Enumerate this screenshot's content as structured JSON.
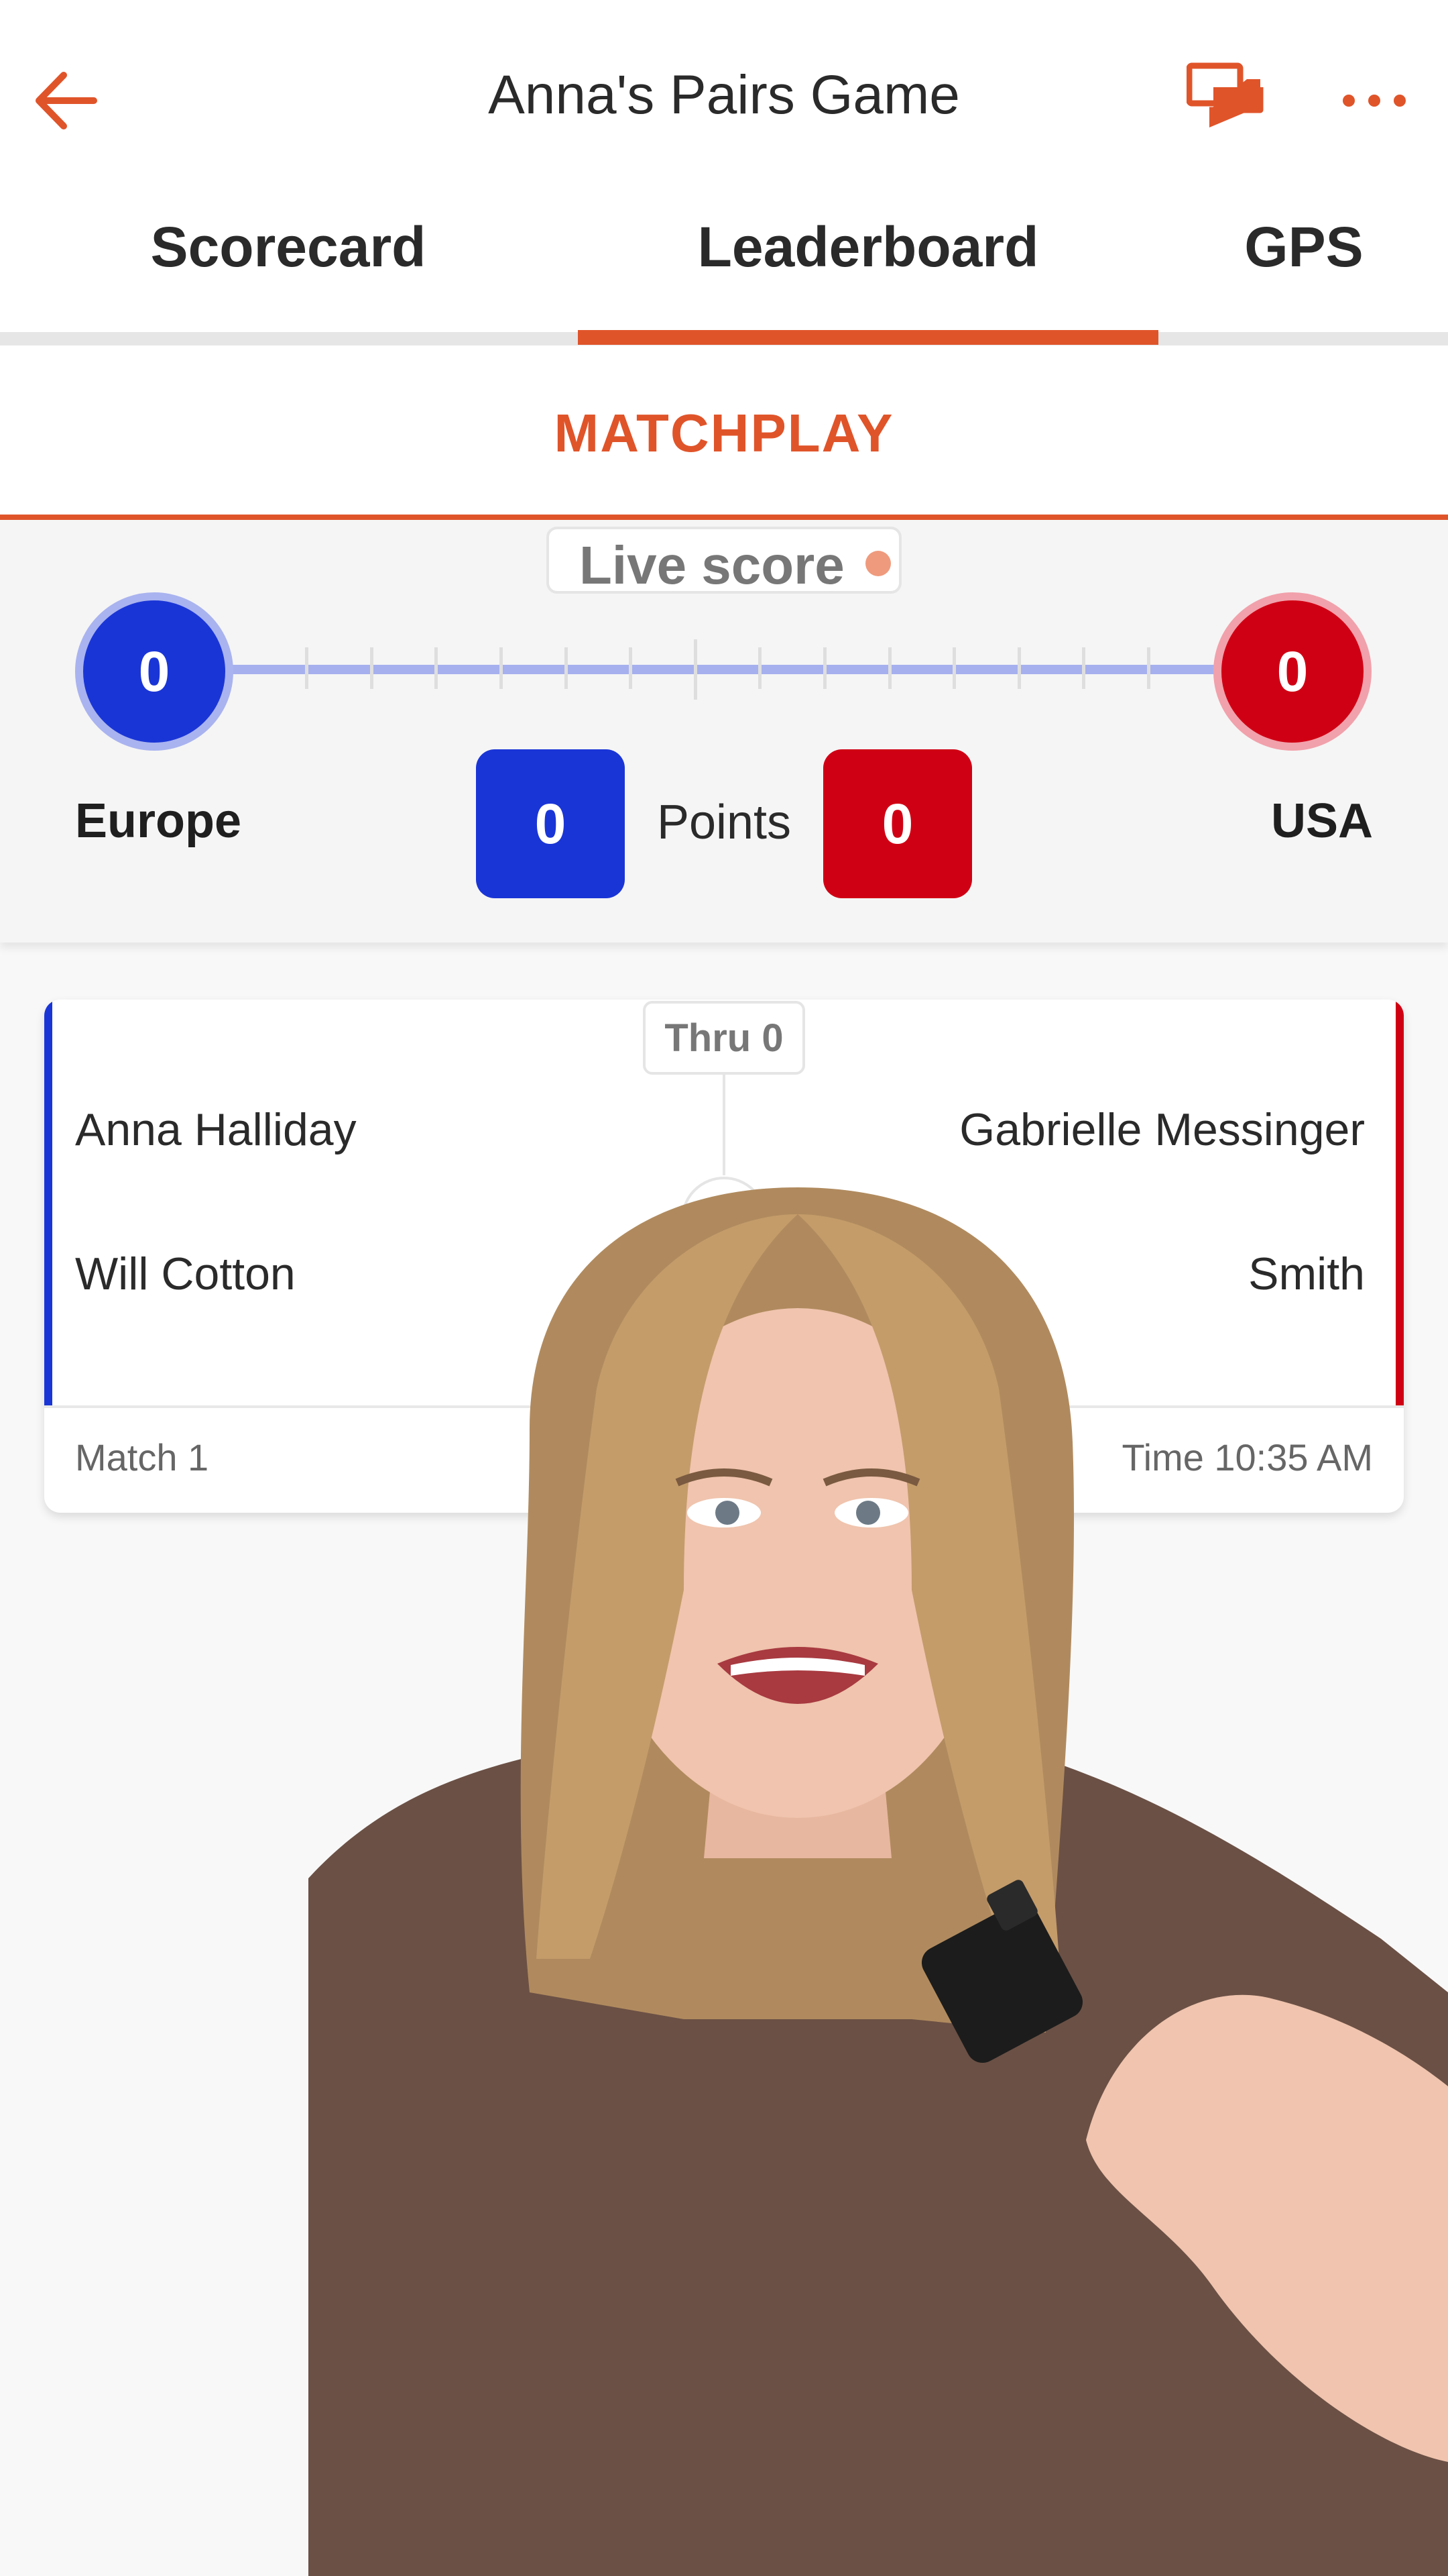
{
  "header": {
    "title": "Anna's Pairs Game"
  },
  "tabs": [
    {
      "label": "Scorecard"
    },
    {
      "label": "Leaderboard",
      "active": true
    },
    {
      "label": "GPS"
    }
  ],
  "mode": {
    "label": "MATCHPLAY"
  },
  "live": {
    "label": "Live score"
  },
  "scoreboard": {
    "team_left": {
      "name": "Europe",
      "holes_up": "0",
      "points": "0",
      "color": "#1a35d6"
    },
    "team_right": {
      "name": "USA",
      "holes_up": "0",
      "points": "0",
      "color": "#d00014"
    },
    "points_label": "Points"
  },
  "match": {
    "thru": "Thru 0",
    "vs": "VS",
    "left_players": [
      "Anna Halliday",
      "Will Cotton"
    ],
    "right_players": [
      "Gabrielle Messinger",
      "Smith"
    ],
    "match_label": "Match 1",
    "tee_time": "Time 10:35 AM"
  },
  "colors": {
    "accent": "#e0542a",
    "europe": "#1a35d6",
    "usa": "#d00014"
  }
}
